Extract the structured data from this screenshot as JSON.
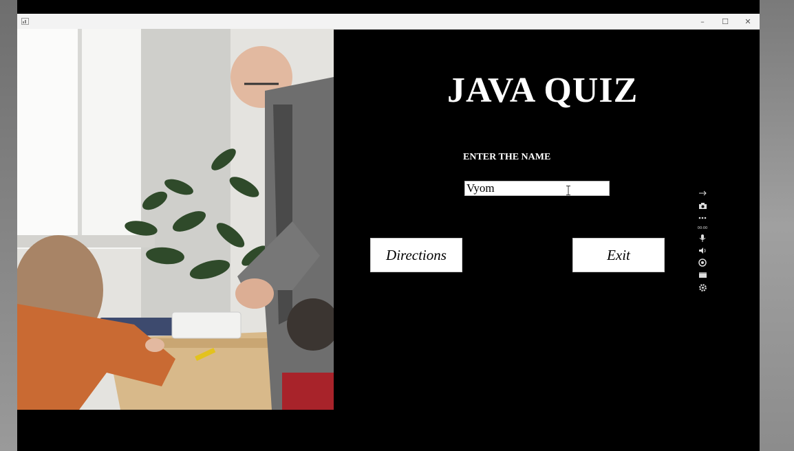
{
  "window": {
    "controls": {
      "minimize": "–",
      "maximize": "☐",
      "close": "✕"
    }
  },
  "quiz": {
    "title": "JAVA QUIZ",
    "name_label": "ENTER THE NAME",
    "name_value": "Vyom",
    "directions_label": "Directions",
    "exit_label": "Exit"
  },
  "recorder_toolbar": {
    "timer": "00:00",
    "icons": [
      "pin-icon",
      "camera-icon",
      "more-icon",
      "microphone-icon",
      "speaker-icon",
      "webcam-icon",
      "window-icon",
      "gear-icon"
    ]
  },
  "colors": {
    "panel": "#000000",
    "button": "#ffffff",
    "titlebar": "#f3f3f3"
  }
}
